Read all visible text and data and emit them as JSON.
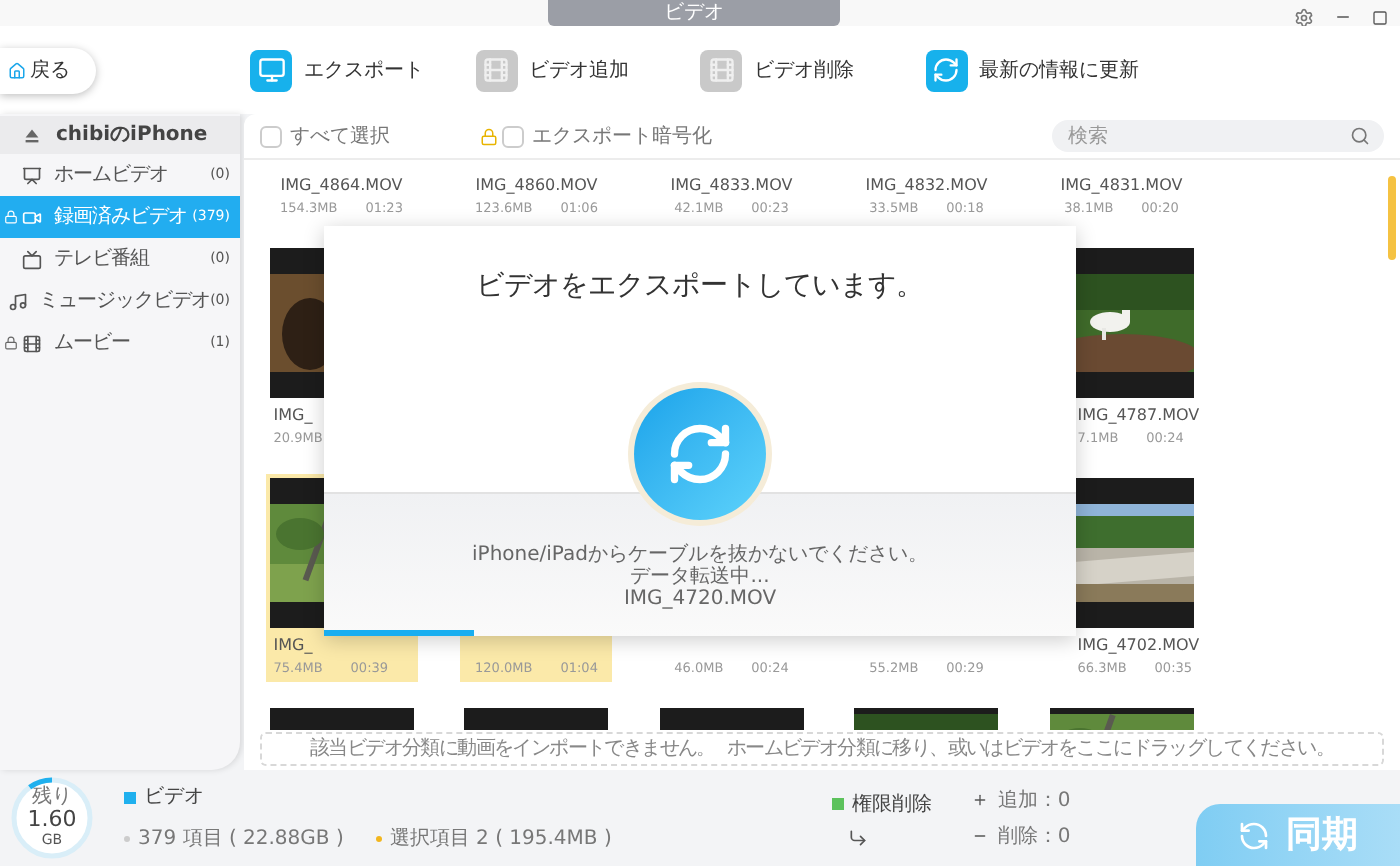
{
  "window": {
    "title": "ビデオ"
  },
  "toolbar": {
    "back": "戻る",
    "actions": [
      {
        "label": "エクスポート",
        "kind": "export",
        "disabled": false
      },
      {
        "label": "ビデオ追加",
        "kind": "add",
        "disabled": true
      },
      {
        "label": "ビデオ削除",
        "kind": "delete",
        "disabled": true
      },
      {
        "label": "最新の情報に更新",
        "kind": "refresh",
        "disabled": false
      }
    ]
  },
  "sidebar": {
    "device": "chibiのiPhone",
    "items": [
      {
        "label": "ホームビデオ",
        "count": "(0)",
        "kind": "home",
        "locked": false,
        "selected": false
      },
      {
        "label": "録画済みビデオ",
        "count": "(379)",
        "kind": "recorded",
        "locked": true,
        "selected": true
      },
      {
        "label": "テレビ番組",
        "count": "(0)",
        "kind": "tv",
        "locked": false,
        "selected": false
      },
      {
        "label": "ミュージックビデオ",
        "count": "(0)",
        "kind": "music",
        "locked": false,
        "selected": false
      },
      {
        "label": "ムービー",
        "count": "(1)",
        "kind": "movie",
        "locked": true,
        "selected": false
      }
    ]
  },
  "list_header": {
    "select_all": {
      "label": "すべて選択",
      "checked": false
    },
    "encrypt": {
      "label": "エクスポート暗号化",
      "checked": false,
      "locked": true
    },
    "search": {
      "placeholder": "検索"
    }
  },
  "videos": {
    "rows": [
      {
        "items": [
          {
            "name": "IMG_4864.MOV",
            "size": "154.3MB",
            "duration": "01:23",
            "selected": false
          },
          {
            "name": "IMG_4860.MOV",
            "size": "123.6MB",
            "duration": "01:06",
            "selected": false
          },
          {
            "name": "IMG_4833.MOV",
            "size": "42.1MB",
            "duration": "00:23",
            "selected": false
          },
          {
            "name": "IMG_4832.MOV",
            "size": "33.5MB",
            "duration": "00:18",
            "selected": false
          },
          {
            "name": "IMG_4831.MOV",
            "size": "38.1MB",
            "duration": "00:20",
            "selected": false
          }
        ]
      },
      {
        "items": [
          {
            "name": "IMG_",
            "size": "20.9MB",
            "picture": true,
            "selected": false
          },
          {
            "name": "IMG_4787.MOV",
            "size": "7.1MB",
            "duration": "00:24",
            "picture": true,
            "selected": false
          }
        ]
      },
      {
        "items": [
          {
            "name": "IMG_",
            "size": "75.4MB",
            "duration": "00:39",
            "picture": true,
            "selected": true
          },
          {
            "size": "120.0MB",
            "duration": "01:04",
            "selected": true
          },
          {
            "size": "46.0MB",
            "duration": "00:24",
            "selected": false
          },
          {
            "size": "55.2MB",
            "duration": "00:29",
            "selected": false
          },
          {
            "name": "IMG_4702.MOV",
            "size": "66.3MB",
            "duration": "00:35",
            "picture": true,
            "selected": false
          }
        ]
      },
      {
        "items": [
          {
            "picture": false
          },
          {
            "picture": false
          },
          {
            "picture": false
          },
          {
            "picture": true
          },
          {
            "picture": true
          }
        ]
      }
    ]
  },
  "drop_hint": [
    "該当ビデオ分類に動画をインポートできません。",
    "ホームビデオ分類に移り、或いはビデオをここにドラッグしてください。"
  ],
  "dialog": {
    "title": "ビデオをエクスポートしています。",
    "lines": [
      "iPhone/iPadからケーブルを抜かないでください。",
      "データ転送中...",
      "IMG_4720.MOV"
    ],
    "level": 0.2
  },
  "footer": {
    "storage": {
      "caption": "残り",
      "value": "1.60",
      "unit": "GB",
      "level": 0.1
    },
    "category": "ビデオ",
    "total": "379 項目 ( 22.88GB )",
    "selected": "選択項目 2 ( 195.4MB )",
    "permission": "権限削除",
    "added": "追加：0",
    "removed": "削除：0"
  },
  "sync_button": "同期"
}
